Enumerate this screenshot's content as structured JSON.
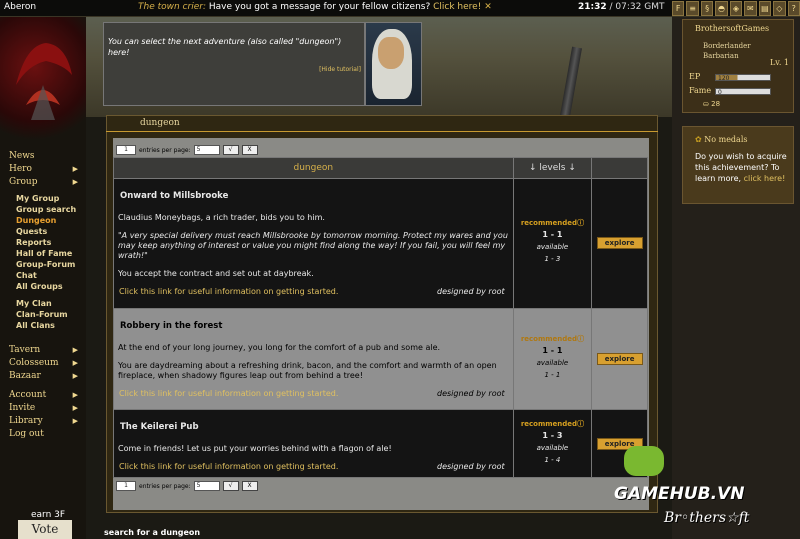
{
  "topbar": {
    "world": "Aberon",
    "crier_label": "The town crier:",
    "crier_text": "Have you got a message for your fellow citizens?",
    "crier_link": "Click here!",
    "time_server": "21:32",
    "time_gmt": "/ 07:32 GMT"
  },
  "nav": {
    "news": "News",
    "hero": "Hero",
    "group": "Group",
    "my_group": "My Group",
    "group_search": "Group search",
    "dungeon": "Dungeon",
    "quests": "Quests",
    "reports": "Reports",
    "hall_of_fame": "Hall of Fame",
    "group_forum": "Group-Forum",
    "chat": "Chat",
    "all_groups": "All Groups",
    "my_clan": "My Clan",
    "clan_forum": "Clan-Forum",
    "all_clans": "All Clans",
    "tavern": "Tavern",
    "colosseum": "Colosseum",
    "bazaar": "Bazaar",
    "account": "Account",
    "invite": "Invite",
    "library": "Library",
    "logout": "Log out",
    "earn": "earn 3F",
    "vote": "Vote"
  },
  "tutorial": {
    "text": "You can select the next adventure (also called \"dungeon\") here!",
    "hide": "[Hide tutorial]"
  },
  "main": {
    "tab": "dungeon",
    "pager": {
      "page": "1",
      "label": "entries per page:",
      "per_page": "5",
      "ok": "√",
      "reset": "X"
    },
    "col_dungeon": "dungeon",
    "col_levels": "↓ levels ↓",
    "rows": [
      {
        "title": "Onward to Millsbrooke",
        "p1": "Claudius Moneybags, a rich trader, bids you to him.",
        "p2": "\"A very special delivery must reach Millsbrooke by tomorrow morning. Protect my wares and you may keep anything of interest or value you might find along the way! If you fail, you will feel my wrath!\"",
        "p3": "You accept the contract and set out at daybreak.",
        "help": "Click this link for useful information on getting started.",
        "by": "designed by root",
        "recommended": "recommended",
        "range": "1 - 1",
        "available": "available",
        "avail_range": "1 - 3",
        "button": "explore"
      },
      {
        "title": "Robbery in the forest",
        "p1": "At the end of your long journey, you long for the comfort of a pub and some ale.",
        "p2": "You are daydreaming about a refreshing drink, bacon, and the comfort and warmth of an open fireplace, when shadowy figures leap out from behind a tree!",
        "help": "Click this link for useful information on getting started.",
        "by": "designed by root",
        "recommended": "recommended",
        "range": "1 - 1",
        "available": "available",
        "avail_range": "1 - 1",
        "button": "explore"
      },
      {
        "title": "The Keilerei Pub",
        "p1": "Come in friends! Let us put your worries behind with a flagon of ale!",
        "help": "Click this link for useful information on getting started.",
        "by": "designed by root",
        "recommended": "recommended",
        "range": "1 - 3",
        "available": "available",
        "avail_range": "1 - 4",
        "button": "explore"
      }
    ],
    "search": "search for a dungeon"
  },
  "character": {
    "name": "BrothersoftGames",
    "class1": "Borderlander",
    "class2": "Barbarian",
    "level": "Lv. 1",
    "ep_label": "EP",
    "ep_value": "120",
    "ep_fraction": 0.4,
    "fame_label": "Fame",
    "fame_value": "0",
    "gold": "28"
  },
  "medals": {
    "title": "No medals",
    "text": "Do you wish to acquire this achievement? To learn more,",
    "link": "click here!"
  },
  "watermark": {
    "brand1": "GAMEHUB.VN",
    "brand2": "Br◦thers☆ft"
  }
}
